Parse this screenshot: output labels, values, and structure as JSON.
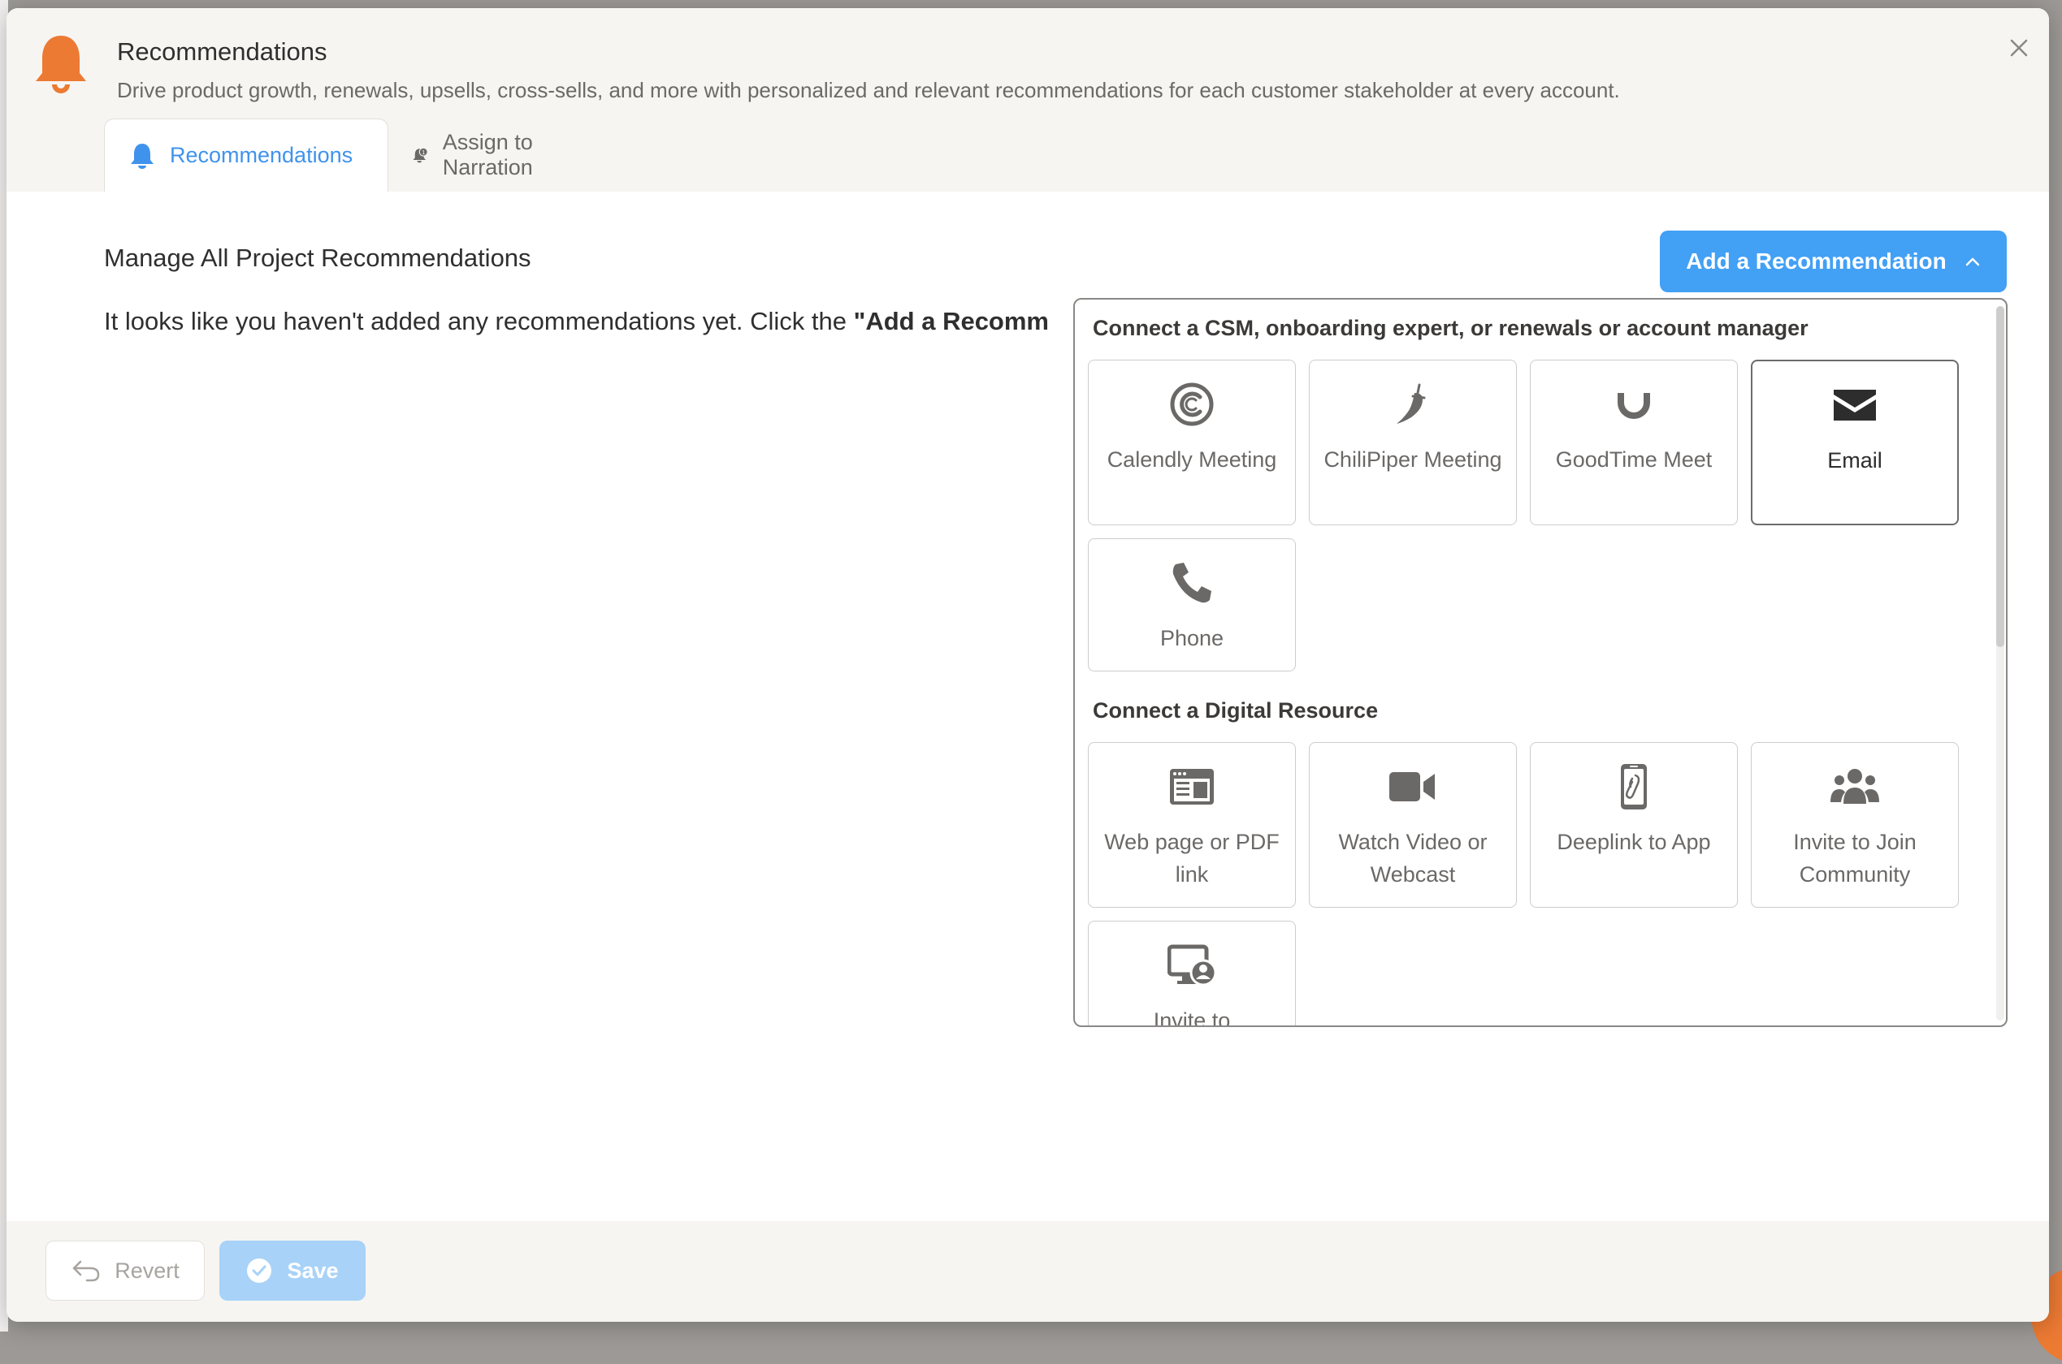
{
  "colors": {
    "accent": "#42a0f5",
    "brand_orange": "#ec7a33",
    "header_bg": "#f7f5f2"
  },
  "modal": {
    "title": "Recommendations",
    "subtitle": "Drive product growth, renewals, upsells, cross-sells, and more with personalized and relevant recommendations for each customer stakeholder at every account.",
    "header_icon": "bell-icon",
    "close_icon": "close-icon"
  },
  "tabs": [
    {
      "label": "Recommendations",
      "icon": "bell-icon",
      "active": true
    },
    {
      "label": "Assign to Narration",
      "icon": "bell-badge-icon",
      "active": false
    }
  ],
  "main": {
    "title": "Manage All Project Recommendations",
    "empty_prefix": "It looks like you haven't added any recommendations yet. Click the ",
    "empty_bold": "\"Add a Recomm"
  },
  "add_button": {
    "label": "Add a Recommendation",
    "icon": "chevron-up-icon"
  },
  "dropdown": {
    "section1": {
      "title": "Connect a CSM, onboarding expert, or renewals or account manager",
      "items": [
        {
          "label": "Calendly Meeting",
          "icon": "calendly-icon"
        },
        {
          "label": "ChiliPiper Meeting",
          "icon": "chilipiper-icon"
        },
        {
          "label": "GoodTime Meet",
          "icon": "goodtime-icon"
        },
        {
          "label": "Email",
          "icon": "envelope-icon",
          "selected": true
        },
        {
          "label": "Phone",
          "icon": "phone-icon"
        }
      ]
    },
    "section2": {
      "title": "Connect a Digital Resource",
      "items": [
        {
          "label": "Web page or PDF link",
          "icon": "webpage-icon"
        },
        {
          "label": "Watch Video or Webcast",
          "icon": "video-camera-icon"
        },
        {
          "label": "Deeplink to App",
          "icon": "mobile-link-icon"
        },
        {
          "label": "Invite to Join Community",
          "icon": "users-icon"
        },
        {
          "label": "Invite to",
          "icon": "screen-user-icon"
        }
      ]
    }
  },
  "footer": {
    "revert_label": "Revert",
    "revert_icon": "undo-icon",
    "save_label": "Save",
    "save_icon": "check-circle-icon"
  }
}
